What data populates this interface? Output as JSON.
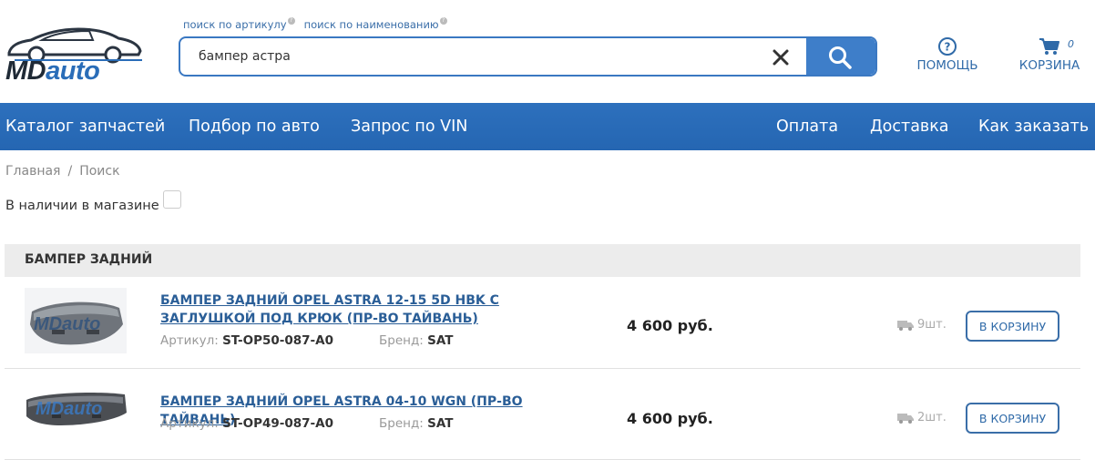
{
  "logo": {
    "part1": "MD",
    "part2": "auto"
  },
  "search": {
    "tabs": [
      {
        "label": "поиск по артикулу"
      },
      {
        "label": "поиск по наименованию"
      }
    ],
    "value": "бампер астра"
  },
  "header": {
    "help_label": "ПОМОЩЬ",
    "cart_label": "КОРЗИНА",
    "cart_count": "0"
  },
  "nav": {
    "left": [
      "Каталог запчастей",
      "Подбор по авто",
      "Запрос по VIN"
    ],
    "right": [
      "Оплата",
      "Доставка",
      "Как заказать"
    ]
  },
  "breadcrumb": {
    "home": "Главная",
    "sep": "/",
    "current": "Поиск"
  },
  "filter": {
    "in_stock_label": "В наличии в магазине",
    "checked": false
  },
  "results": {
    "group_title": "БАМПЕР ЗАДНИЙ",
    "items": [
      {
        "name": "БАМПЕР ЗАДНИЙ OPEL ASTRA 12-15 5D HBK С ЗАГЛУШКОЙ ПОД КРЮК (ПР-ВО ТАЙВАНЬ)",
        "article_label": "Артикул:",
        "article": "ST-OP50-087-A0",
        "brand_label": "Бренд:",
        "brand": "SAT",
        "price": "4 600 руб.",
        "stock": "9шт.",
        "button": "В КОРЗИНУ",
        "watermark": "MDauto"
      },
      {
        "name": "БАМПЕР ЗАДНИЙ OPEL ASTRA 04-10 WGN (ПР-ВО ТАЙВАНЬ)",
        "article_label": "Артикул:",
        "article": "ST-OP49-087-A0",
        "brand_label": "Бренд:",
        "brand": "SAT",
        "price": "4 600 руб.",
        "stock": "2шт.",
        "button": "В КОРЗИНУ",
        "watermark": "MDauto"
      }
    ]
  },
  "colors": {
    "accent": "#2d70bd",
    "link": "#2a5e97",
    "group_bg": "#ececec"
  }
}
